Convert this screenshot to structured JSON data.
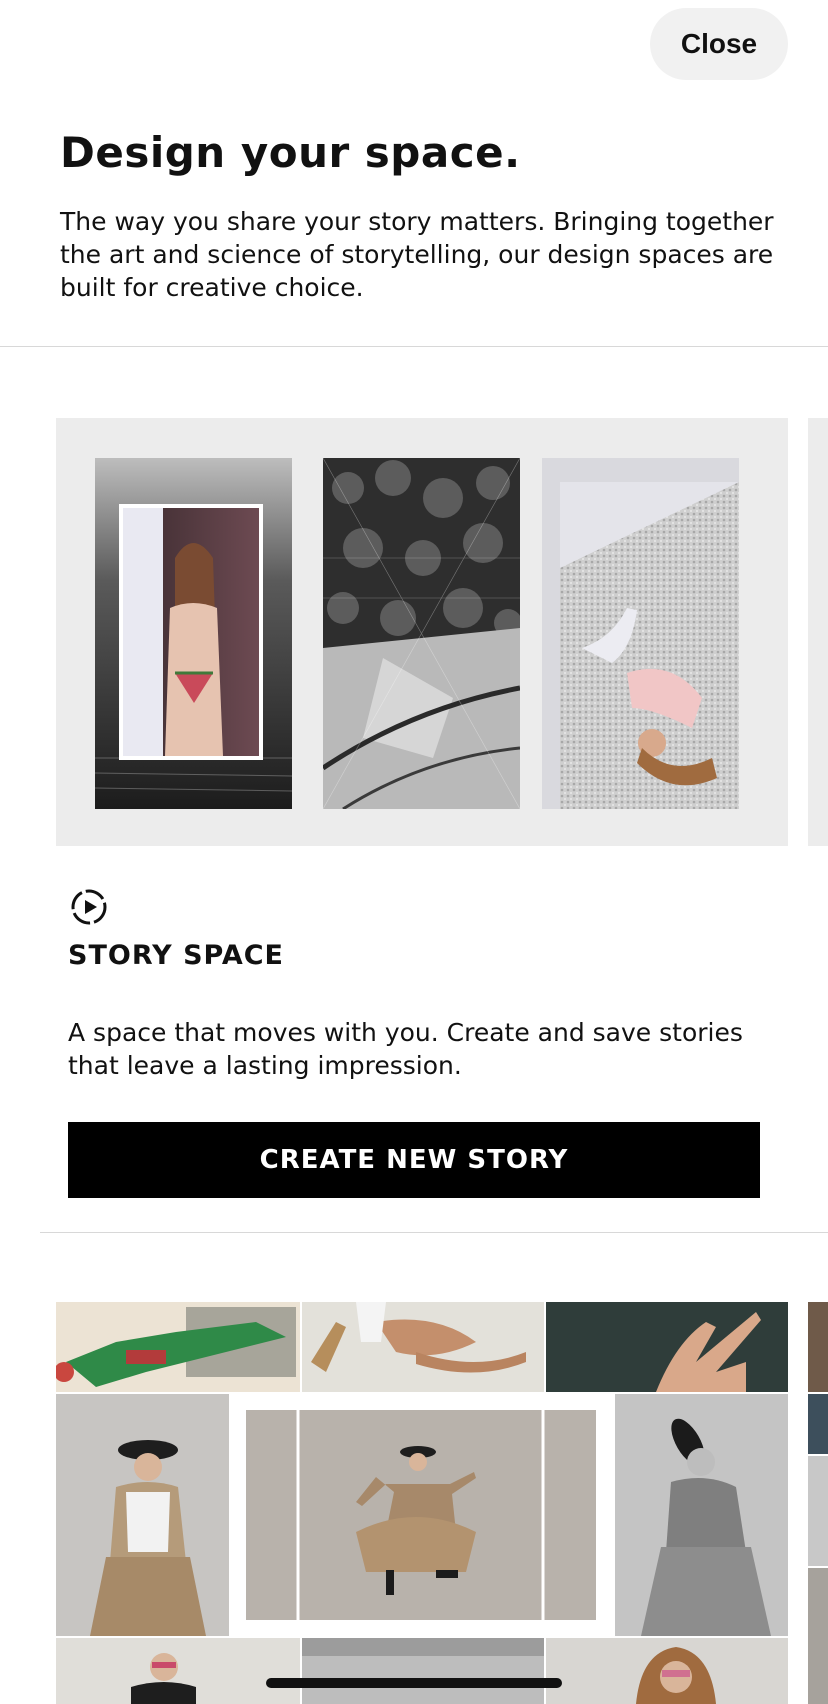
{
  "header": {
    "close_label": "Close"
  },
  "intro": {
    "title": "Design your space.",
    "description": "The way you share your story matters. Bringing together the art and science of storytelling, our design spaces are built for creative choice."
  },
  "story_space": {
    "icon": "story-play-icon",
    "title": "STORY SPACE",
    "description": "A space that moves with you. Create and save stories that leave a lasting impression.",
    "cta_label": "CREATE NEW STORY"
  },
  "colors": {
    "button_bg": "#000000",
    "panel_bg": "#ececec",
    "close_bg": "#f1f1f1"
  }
}
